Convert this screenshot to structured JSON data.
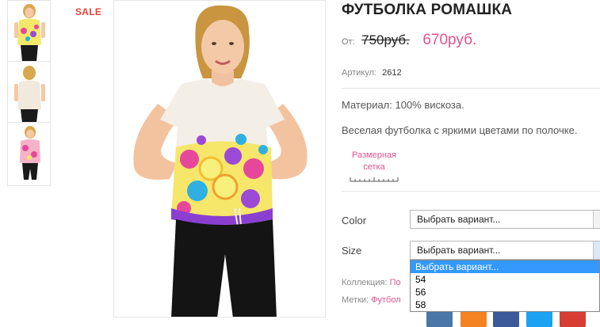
{
  "badge": {
    "sale": "SALE"
  },
  "product": {
    "title": "ФУТБОЛКА РОМАШКА",
    "price_from": "От:",
    "price_old": "750руб.",
    "price_new": "670руб.",
    "sku_label": "Артикул:",
    "sku_value": "2612",
    "material": "Материал: 100% вискоза.",
    "description": "Веселая футболка с яркими цветами по полочке."
  },
  "size_chart": {
    "line1": "Размерная",
    "line2": "сетка"
  },
  "options": {
    "color_label": "Color",
    "color_value": "Выбрать вариант...",
    "size_label": "Size",
    "size_value": "Выбрать вариант...",
    "size_dropdown": [
      "Выбрать вариант...",
      "54",
      "56",
      "58"
    ]
  },
  "meta": {
    "collection_label": "Коллекция:",
    "collection_link": "По",
    "tags_label": "Метки:",
    "tags_link": "Футбол"
  },
  "social": {
    "icons": [
      "vk-icon",
      "odnoklassniki-icon",
      "facebook-icon",
      "twitter-icon",
      "googleplus-icon"
    ],
    "colors": [
      "#4a76a8",
      "#f58220",
      "#3b5998",
      "#1da1f2",
      "#d73d32"
    ]
  },
  "colors": {
    "accent": "#e0538f",
    "sale": "#e8413e",
    "selected_option": "#3399ff"
  }
}
